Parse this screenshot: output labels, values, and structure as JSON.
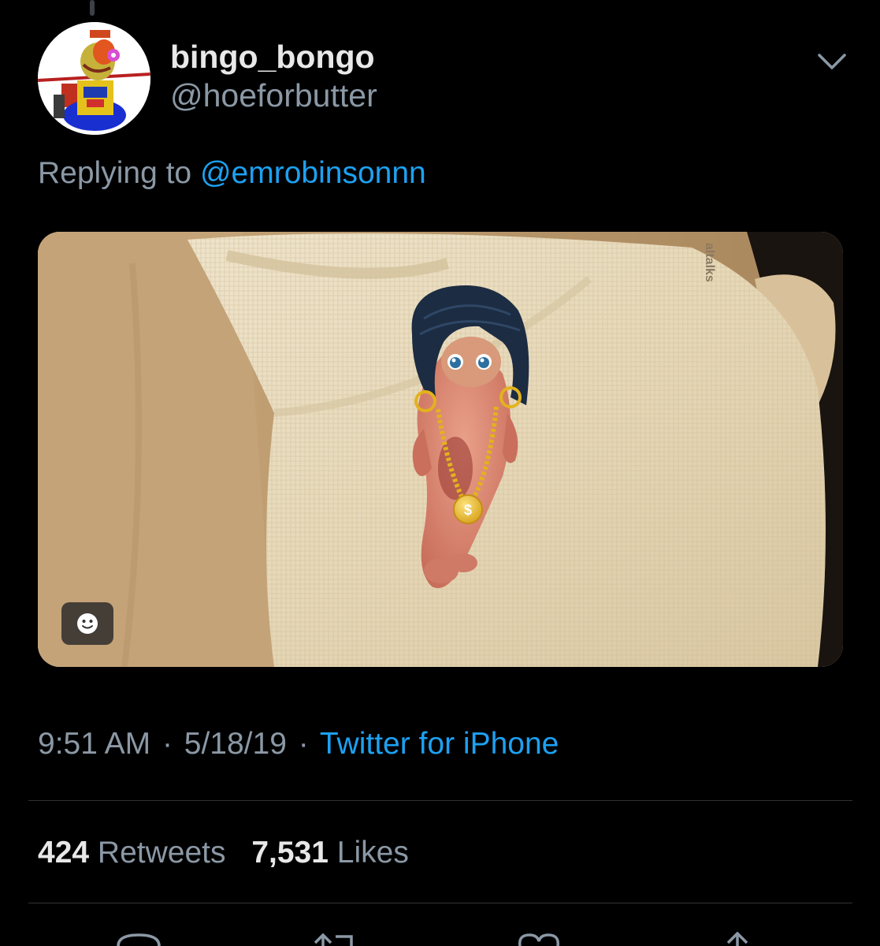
{
  "tweet": {
    "display_name": "bingo_bongo",
    "handle": "@hoeforbutter",
    "replying_prefix": "Replying to",
    "replying_to": "@emrobinsonnn",
    "media_watermark": "altalks",
    "time": "9:51 AM",
    "date": "5/18/19",
    "separator": "·",
    "source": "Twitter for iPhone",
    "retweets_count": "424",
    "retweets_label": "Retweets",
    "likes_count": "7,531",
    "likes_label": "Likes"
  },
  "icons": {
    "more": "chevron-down-icon",
    "sticker": "smiley-icon",
    "reply": "reply-icon",
    "retweet": "retweet-icon",
    "like": "heart-icon",
    "share": "share-icon"
  },
  "colors": {
    "background": "#000000",
    "primary_text": "#e8e8e8",
    "secondary_text": "#8b98a5",
    "link": "#1da1f2",
    "divider": "#2f3336"
  }
}
